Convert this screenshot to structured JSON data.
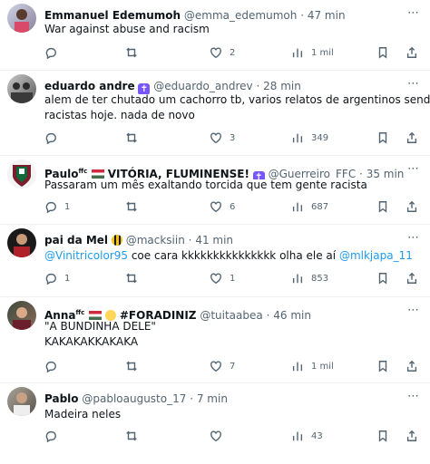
{
  "tweets": [
    {
      "name": "Emmanuel Edemumoh",
      "handle": "@emma_edemumoh",
      "time": "47 min",
      "lines": [
        "War against abuse and racism"
      ],
      "likes": "2",
      "views": "1 mil"
    },
    {
      "name": "eduardo andre",
      "handle": "@eduardo_andrev",
      "time": "28 min",
      "lines": [
        "alem de ter chutado um cachorro tb, varios relatos de argentinos sendo",
        "racistas hoje. nada de novo"
      ],
      "likes": "3",
      "views": "349"
    },
    {
      "name": "Paulo",
      "name_sup": "ffc",
      "name_extra": "VITÓRIA, FLUMINENSE!",
      "handle": "@Guerreiro_FFC",
      "time": "35 min",
      "lines": [
        "Passaram um mês exaltando torcida que tem gente racista"
      ],
      "replies": "1",
      "likes": "6",
      "views": "687"
    },
    {
      "name": "pai da Mel",
      "handle": "@macksiin",
      "time": "41 min",
      "mention1": "@Vinitricolor95",
      "mid_text": " coe cara kkkkkkkkkkkkkkk olha ele aí ",
      "mention2": "@mlkjapa_11",
      "replies": "1",
      "likes": "1",
      "views": "853"
    },
    {
      "name": "Anna",
      "name_sup": "ffc",
      "name_extra": "#FORADINIZ",
      "handle": "@tuitaabea",
      "time": "46 min",
      "lines": [
        "\"A BUNDINHA DELE\"",
        "KAKAKAKKAKAKA"
      ],
      "likes": "7",
      "views": "1 mil"
    },
    {
      "name": "Pablo",
      "handle": "@pabloaugusto_17",
      "time": "7 min",
      "lines": [
        "Madeira neles"
      ],
      "views": "43"
    }
  ],
  "sep": "·",
  "more_icon": "⋯",
  "badge_cross": "✝"
}
